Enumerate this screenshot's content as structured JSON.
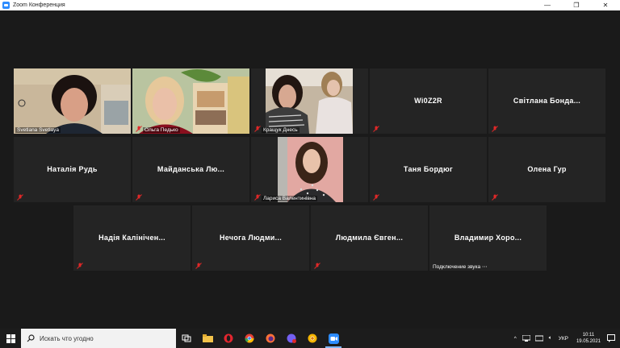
{
  "window": {
    "title": "Zoom Конференция",
    "minimize": "—",
    "maximize": "❐",
    "close": "✕"
  },
  "tiles": {
    "t1": {
      "label": "Svetlana Svetlaya"
    },
    "t2": {
      "label": "Ольга Педько"
    },
    "t3": {
      "label": "Кращук Днесь"
    },
    "t4": {
      "name": "Wi0Z2R"
    },
    "t5": {
      "name": "Світлана Бонда..."
    },
    "t6": {
      "name": "Наталія Рудь"
    },
    "t7": {
      "name": "Майданська Лю..."
    },
    "t8": {
      "label": "Лариса Валентинівна"
    },
    "t9": {
      "name": "Таня Бордюг"
    },
    "t10": {
      "name": "Олена Гур"
    },
    "t11": {
      "name": "Надія Калінічен..."
    },
    "t12": {
      "name": "Нечога Людми..."
    },
    "t13": {
      "name": "Людмила Євген..."
    },
    "t14": {
      "name": "Владимир Хоро...",
      "status": "Подключение звука ⋯"
    }
  },
  "taskbar": {
    "search_placeholder": "Искать что угодно",
    "language": "УКР",
    "time": "10:11",
    "date": "19.05.2021"
  },
  "colors": {
    "active_speaker": "#c5e63a",
    "muted": "#e02828",
    "tile_bg": "#242424",
    "stage_bg": "#1a1a1a"
  }
}
